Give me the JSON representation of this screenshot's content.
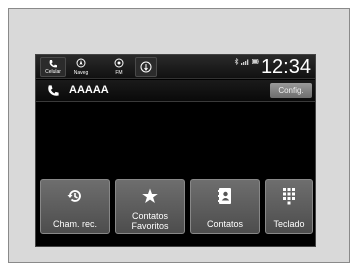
{
  "status_bar": {
    "sources": [
      {
        "label": "Celular",
        "icon": "phone-icon",
        "selected": true
      },
      {
        "label": "Naveg",
        "icon": "navigation-icon",
        "selected": false
      },
      {
        "label": "FM",
        "icon": "radio-icon",
        "selected": false
      },
      {
        "label": "",
        "icon": "audio-source-icon",
        "selected": false
      }
    ],
    "clock": "12:34"
  },
  "contact": {
    "name": "AAAAA",
    "config_label": "Config."
  },
  "menu": [
    {
      "label": "Cham. rec.",
      "icon": "history-icon"
    },
    {
      "label": "Contatos\nFavoritos",
      "icon": "star-icon"
    },
    {
      "label": "Contatos",
      "icon": "phonebook-icon"
    },
    {
      "label": "Teclado",
      "icon": "keypad-icon"
    }
  ],
  "colors": {
    "background": "#000000",
    "button_gradient_top": "#6e6e6e",
    "button_gradient_bottom": "#4d4d4d",
    "config_button": "#8a8a8a",
    "text": "#ffffff"
  }
}
